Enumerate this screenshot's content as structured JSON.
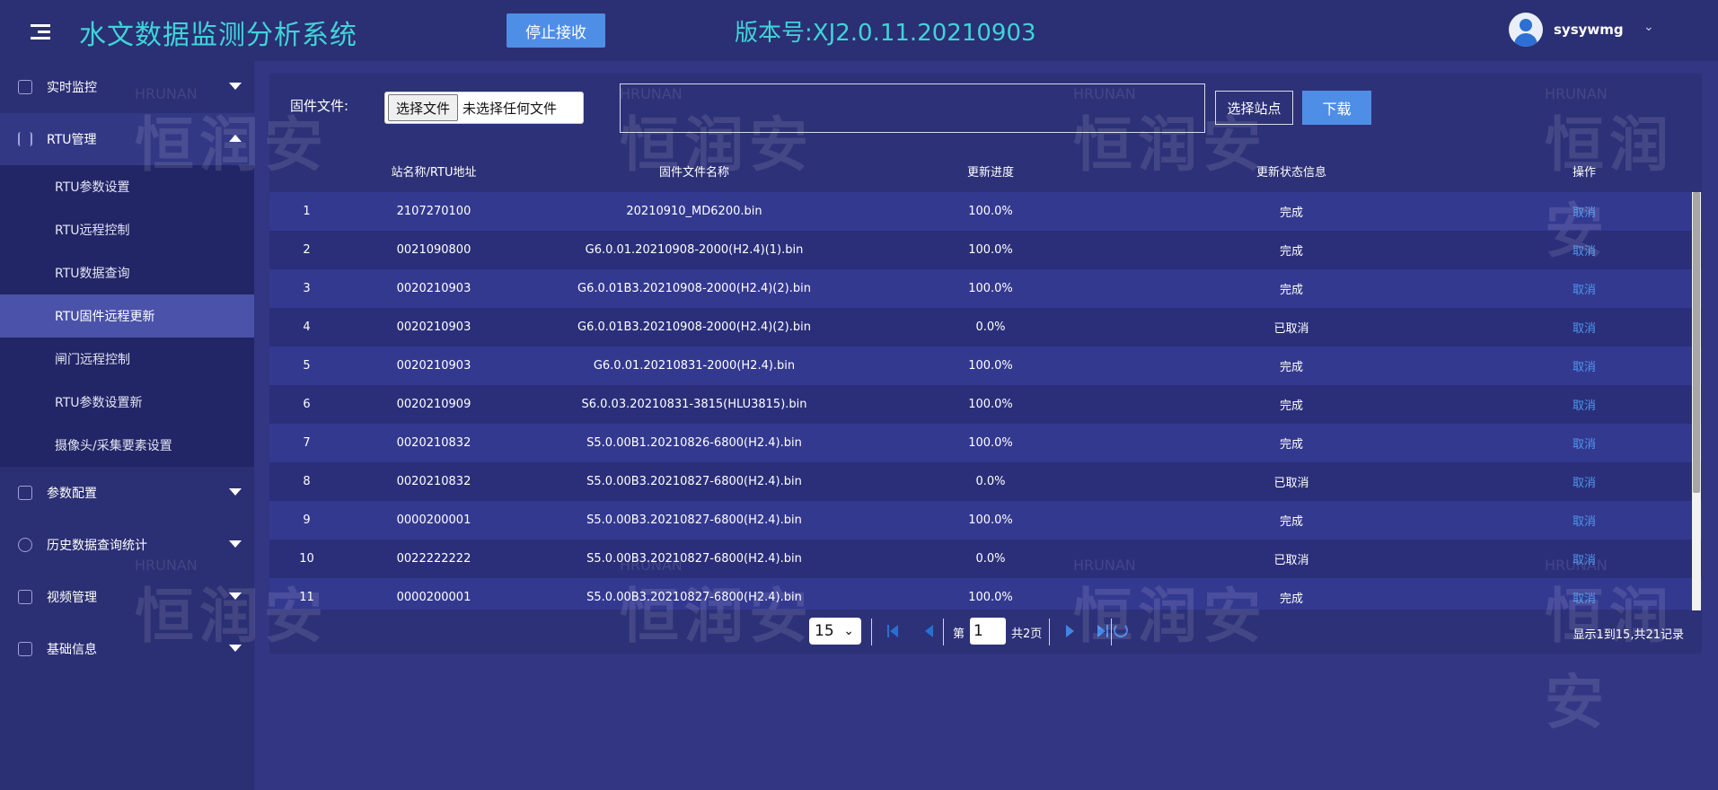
{
  "header": {
    "title": "水文数据监测分析系统",
    "stop_button": "停止接收",
    "version": "版本号:XJ2.0.11.20210903",
    "username": "sysywmg"
  },
  "sidebar": {
    "items": [
      {
        "label": "实时监控",
        "icon": "monitor-icon"
      },
      {
        "label": "RTU管理",
        "icon": "bars-icon"
      },
      {
        "label": "参数配置",
        "icon": "book-icon"
      },
      {
        "label": "历史数据查询统计",
        "icon": "target-icon"
      },
      {
        "label": "视频管理",
        "icon": "video-icon"
      },
      {
        "label": "基础信息",
        "icon": "list-icon"
      }
    ],
    "sub_items": [
      "RTU参数设置",
      "RTU远程控制",
      "RTU数据查询",
      "RTU固件远程更新",
      "闸门远程控制",
      "RTU参数设置新",
      "摄像头/采集要素设置"
    ]
  },
  "toolbar": {
    "firmware_label": "固件文件:",
    "choose_file": "选择文件",
    "no_file": "未选择任何文件",
    "select_station": "选择站点",
    "download": "下载"
  },
  "table": {
    "columns": [
      "",
      "站名称/RTU地址",
      "固件文件名称",
      "更新进度",
      "更新状态信息",
      "操作"
    ],
    "rows": [
      [
        "1",
        "2107270100",
        "20210910_MD6200.bin",
        "100.0%",
        "完成",
        "取消"
      ],
      [
        "2",
        "0021090800",
        "G6.0.01.20210908-2000(H2.4)(1).bin",
        "100.0%",
        "完成",
        "取消"
      ],
      [
        "3",
        "0020210903",
        "G6.0.01B3.20210908-2000(H2.4)(2).bin",
        "100.0%",
        "完成",
        "取消"
      ],
      [
        "4",
        "0020210903",
        "G6.0.01B3.20210908-2000(H2.4)(2).bin",
        "0.0%",
        "已取消",
        "取消"
      ],
      [
        "5",
        "0020210903",
        "G6.0.01.20210831-2000(H2.4).bin",
        "100.0%",
        "完成",
        "取消"
      ],
      [
        "6",
        "0020210909",
        "S6.0.03.20210831-3815(HLU3815).bin",
        "100.0%",
        "完成",
        "取消"
      ],
      [
        "7",
        "0020210832",
        "S5.0.00B1.20210826-6800(H2.4).bin",
        "100.0%",
        "完成",
        "取消"
      ],
      [
        "8",
        "0020210832",
        "S5.0.00B3.20210827-6800(H2.4).bin",
        "0.0%",
        "已取消",
        "取消"
      ],
      [
        "9",
        "0000200001",
        "S5.0.00B3.20210827-6800(H2.4).bin",
        "100.0%",
        "完成",
        "取消"
      ],
      [
        "10",
        "0022222222",
        "S5.0.00B3.20210827-6800(H2.4).bin",
        "0.0%",
        "已取消",
        "取消"
      ],
      [
        "11",
        "0000200001",
        "S5.0.00B3.20210827-6800(H2.4).bin",
        "100.0%",
        "完成",
        "取消"
      ]
    ]
  },
  "pager": {
    "page_size": "15",
    "page_prefix": "第",
    "page_value": "1",
    "page_total": "共2页",
    "record_info": "显示1到15,共21记录"
  },
  "watermark": {
    "en": "HRUNAN",
    "cn": "恒润安"
  },
  "colors": {
    "accent": "#3fd4d8",
    "button": "#4f8ee6",
    "link": "#4d97ea",
    "active_nav": "#4a52a9"
  }
}
